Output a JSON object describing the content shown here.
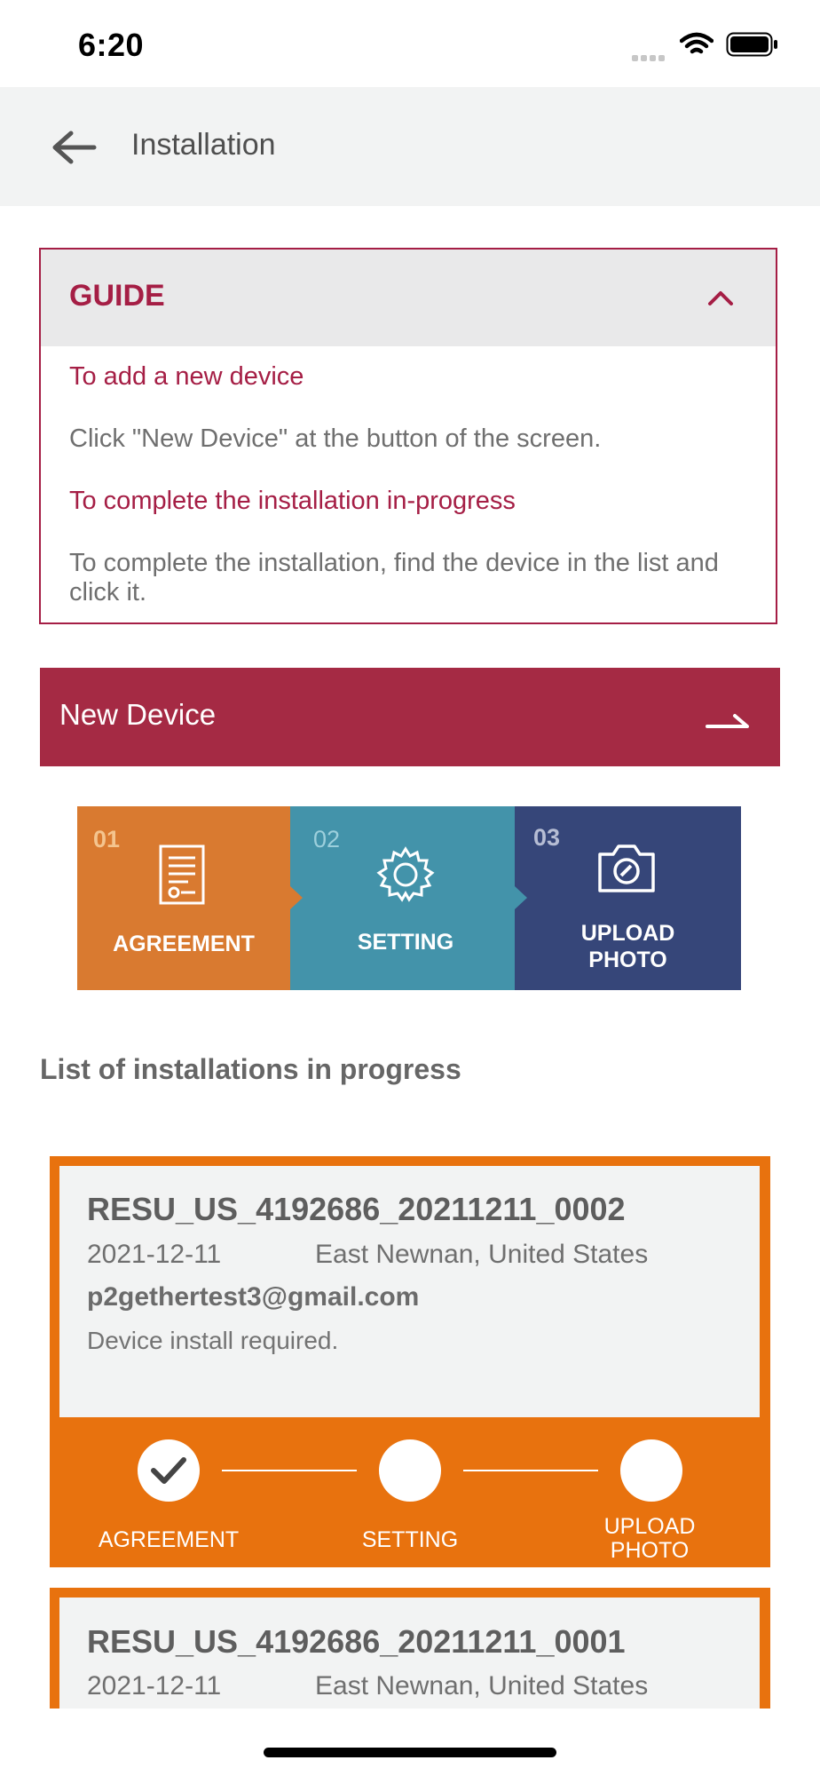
{
  "status_bar": {
    "time": "6:20"
  },
  "header": {
    "title": "Installation"
  },
  "guide": {
    "title": "GUIDE",
    "items": [
      {
        "heading": "To add a new device",
        "text": "Click \"New Device\" at the button of the screen."
      },
      {
        "heading": "To complete the installation in-progress",
        "text": "To complete the installation, find the device in the list and click it."
      }
    ]
  },
  "new_device": {
    "label": "New Device"
  },
  "steps": [
    {
      "number": "01",
      "label": "AGREEMENT",
      "icon": "document-icon",
      "color": "#d97a30"
    },
    {
      "number": "02",
      "label": "SETTING",
      "icon": "gear-icon",
      "color": "#4393aa"
    },
    {
      "number": "03",
      "label": "UPLOAD PHOTO",
      "icon": "camera-icon",
      "color": "#364679"
    }
  ],
  "list_title": "List of installations in progress",
  "installations": [
    {
      "id": "RESU_US_4192686_20211211_0002",
      "date": "2021-12-11",
      "location": "East Newnan, United States",
      "email": "p2gethertest3@gmail.com",
      "status": "Device install required.",
      "progress": [
        {
          "label": "AGREEMENT",
          "done": true
        },
        {
          "label": "SETTING",
          "done": false
        },
        {
          "label": "UPLOAD PHOTO",
          "done": false
        }
      ]
    },
    {
      "id": "RESU_US_4192686_20211211_0001",
      "date": "2021-12-11",
      "location": "East Newnan, United States"
    }
  ],
  "colors": {
    "accent": "#a51e45",
    "card_border": "#e8720e",
    "header_bg": "#f2f3f3"
  }
}
